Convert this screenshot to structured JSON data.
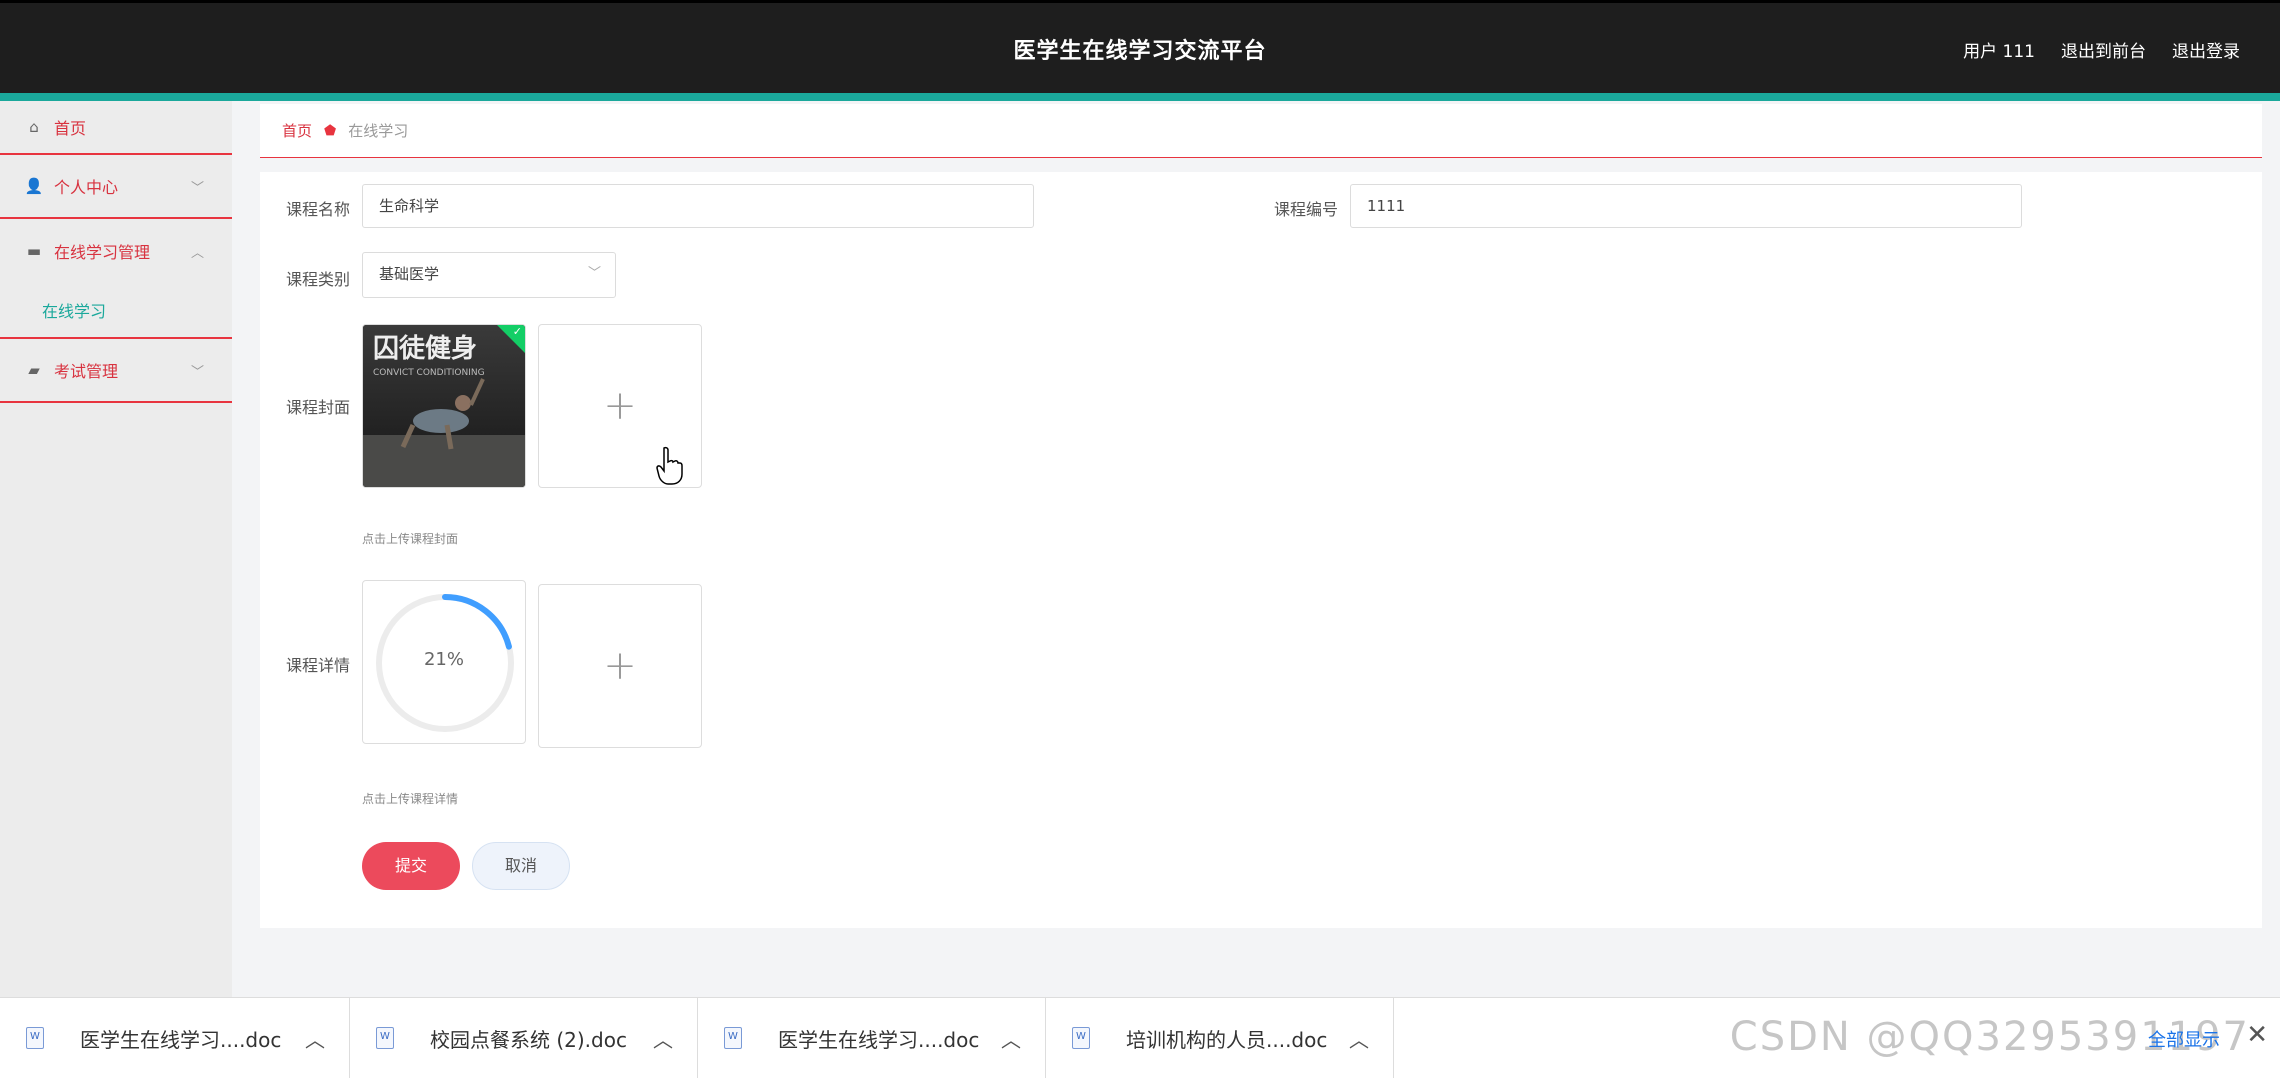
{
  "header": {
    "app_title": "医学生在线学习交流平台",
    "user_label": "用户 111",
    "link_front": "退出到前台",
    "link_logout": "退出登录",
    "bg_color": "#1e1e1e",
    "accent_color": "#1aa89b"
  },
  "sidebar": {
    "items": [
      {
        "label": "首页",
        "icon": "home-icon"
      },
      {
        "label": "个人中心",
        "icon": "user-icon"
      },
      {
        "label": "在线学习管理",
        "icon": "course-icon",
        "sub": [
          "在线学习"
        ]
      },
      {
        "label": "考试管理",
        "icon": "exam-icon"
      }
    ]
  },
  "breadcrumb": {
    "home": "首页",
    "current": "在线学习"
  },
  "form": {
    "course_name_label": "课程名称",
    "course_name_value": "生命科学",
    "course_code_label": "课程编号",
    "course_code_value": "1111",
    "category_label": "课程类别",
    "category_value": "基础医学",
    "cover_label": "课程封面",
    "cover_thumb_title": "囚徒健身",
    "cover_thumb_sub": "CONVICT CONDITIONING",
    "cover_hint": "点击上传课程封面",
    "detail_label": "课程详情",
    "detail_progress": "21%",
    "detail_progress_value": 21,
    "detail_hint": "点击上传课程详情",
    "submit_label": "提交",
    "cancel_label": "取消"
  },
  "downloads": {
    "items": [
      "医学生在线学习....doc",
      "校园点餐系统 (2).doc",
      "医学生在线学习....doc",
      "培训机构的人员....doc"
    ],
    "show_all": "全部显示",
    "watermark": "CSDN @QQ3295391197"
  }
}
